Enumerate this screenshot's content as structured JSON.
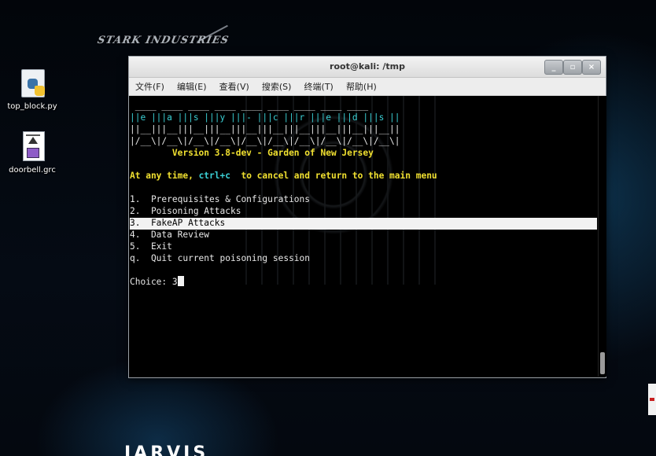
{
  "desktop": {
    "brand_logo_text": "STARK INDUSTRIES",
    "jarvis_text": "JARVIS",
    "icons": [
      {
        "label": "top_block.py",
        "icon": "python-file-icon"
      },
      {
        "label": "doorbell.grc",
        "icon": "gnuradio-file-icon"
      }
    ]
  },
  "window": {
    "title": "root@kali: /tmp",
    "controls": {
      "minimize": "_",
      "maximize": "▫",
      "close": "×"
    },
    "menu": [
      "文件(F)",
      "编辑(E)",
      "查看(V)",
      "搜索(S)",
      "终端(T)",
      "帮助(H)"
    ]
  },
  "terminal": {
    "banner": [
      " ____ ____ ____ ____ ____ ____ ____ ____ ____",
      "||e |||a |||s |||y |||- |||c |||r |||e |||d |||s ||",
      "||__|||__|||__|||__|||__|||__|||__|||__|||__|||__||",
      "|/__\\|/__\\|/__\\|/__\\|/__\\|/__\\|/__\\|/__\\|/__\\|/__\\|"
    ],
    "version": "        Version 3.8-dev - Garden of New Jersey",
    "instruction": "At any time, ctrl+c  to cancel and return to the main menu",
    "menu_items": [
      "1.  Prerequisites & Configurations",
      "2.  Poisoning Attacks",
      "3.  FakeAP Attacks",
      "4.  Data Review",
      "5.  Exit",
      "q.  Quit current poisoning session"
    ],
    "selected_index": 2,
    "prompt": "Choice: ",
    "input_value": "3",
    "colors": {
      "banner": "#3bd1d6",
      "accent": "#f0e030",
      "text": "#e8e8e8",
      "highlight": "#f2f2f2"
    }
  }
}
